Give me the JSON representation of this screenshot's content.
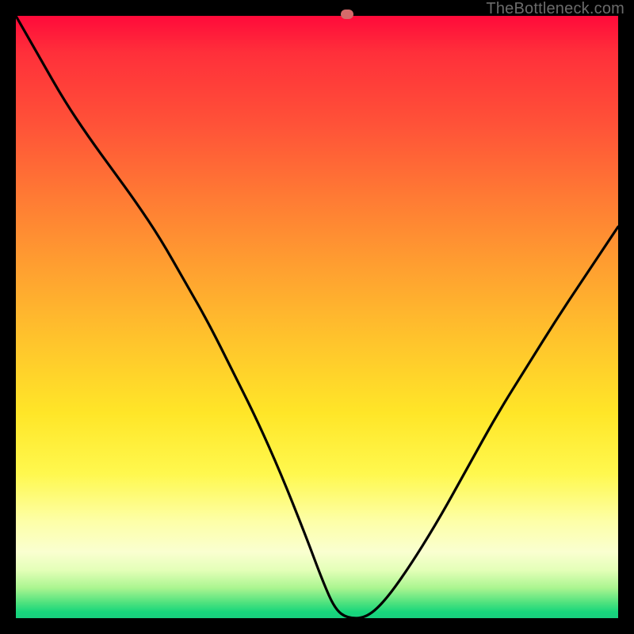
{
  "watermark": "TheBottleneck.com",
  "marker": {
    "x_pct": 55,
    "y_pct": 100,
    "color": "#d46a6a"
  },
  "chart_data": {
    "type": "line",
    "title": "",
    "xlabel": "",
    "ylabel": "",
    "xlim": [
      0,
      100
    ],
    "ylim": [
      0,
      100
    ],
    "series": [
      {
        "name": "bottleneck-curve",
        "x": [
          0,
          4,
          8,
          12,
          16,
          20,
          24,
          28,
          32,
          36,
          40,
          44,
          48,
          51,
          53,
          55,
          58,
          61,
          65,
          70,
          75,
          80,
          85,
          90,
          95,
          100
        ],
        "y": [
          100,
          93,
          86,
          80,
          74.5,
          69,
          63,
          56,
          49,
          41,
          33,
          24,
          14,
          6,
          1.5,
          0,
          0,
          2.5,
          8,
          16,
          25,
          34,
          42,
          50,
          57.5,
          65
        ]
      }
    ],
    "background_gradient": {
      "orientation": "vertical",
      "stops": [
        {
          "pos": 0.0,
          "color": "#ff0a3a"
        },
        {
          "pos": 0.3,
          "color": "#ff7a34"
        },
        {
          "pos": 0.6,
          "color": "#ffd82a"
        },
        {
          "pos": 0.85,
          "color": "#fdffb8"
        },
        {
          "pos": 1.0,
          "color": "#18cf7e"
        }
      ]
    },
    "annotations": []
  }
}
